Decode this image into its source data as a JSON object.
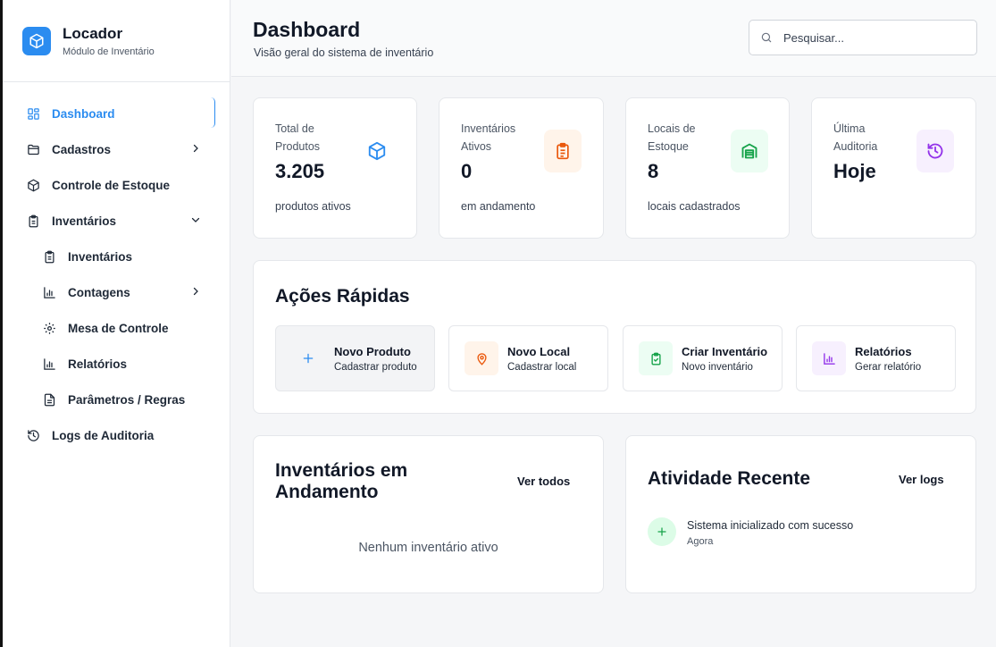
{
  "sidebar": {
    "brand_name": "Locador",
    "brand_subtitle": "Módulo de Inventário",
    "items": [
      {
        "label": "Dashboard"
      },
      {
        "label": "Cadastros"
      },
      {
        "label": "Controle de Estoque"
      },
      {
        "label": "Inventários"
      },
      {
        "label": "Inventários"
      },
      {
        "label": "Contagens"
      },
      {
        "label": "Mesa de Controle"
      },
      {
        "label": "Relatórios"
      },
      {
        "label": "Parâmetros / Regras"
      },
      {
        "label": "Logs de Auditoria"
      }
    ]
  },
  "header": {
    "title": "Dashboard",
    "subtitle": "Visão geral do sistema de inventário",
    "search_placeholder": "Pesquisar..."
  },
  "stats": [
    {
      "label": "Total de Produtos",
      "value": "3.205",
      "foot": "produtos ativos",
      "icon": "box-icon",
      "color": "#2b8cf0"
    },
    {
      "label": "Inventários Ativos",
      "value": "0",
      "foot": "em andamento",
      "icon": "clipboard-list-icon",
      "color": "#ea580c"
    },
    {
      "label": "Locais de Estoque",
      "value": "8",
      "foot": "locais cadastrados",
      "icon": "warehouse-icon",
      "color": "#16a34a"
    },
    {
      "label": "Última Auditoria",
      "value": "Hoje",
      "foot": "",
      "icon": "history-icon",
      "color": "#9333ea"
    }
  ],
  "quick_actions": {
    "title": "Ações Rápidas",
    "items": [
      {
        "title": "Novo Produto",
        "subtitle": "Cadastrar produto",
        "icon": "plus-icon"
      },
      {
        "title": "Novo Local",
        "subtitle": "Cadastrar local",
        "icon": "map-pin-icon"
      },
      {
        "title": "Criar Inventário",
        "subtitle": "Novo inventário",
        "icon": "clipboard-check-icon"
      },
      {
        "title": "Relatórios",
        "subtitle": "Gerar relatório",
        "icon": "bar-chart-icon"
      }
    ]
  },
  "inventories_in_progress": {
    "title": "Inventários em Andamento",
    "link": "Ver todos",
    "empty": "Nenhum inventário ativo"
  },
  "recent_activity": {
    "title": "Atividade Recente",
    "link": "Ver logs",
    "items": [
      {
        "text": "Sistema inicializado com sucesso",
        "time": "Agora"
      }
    ]
  }
}
